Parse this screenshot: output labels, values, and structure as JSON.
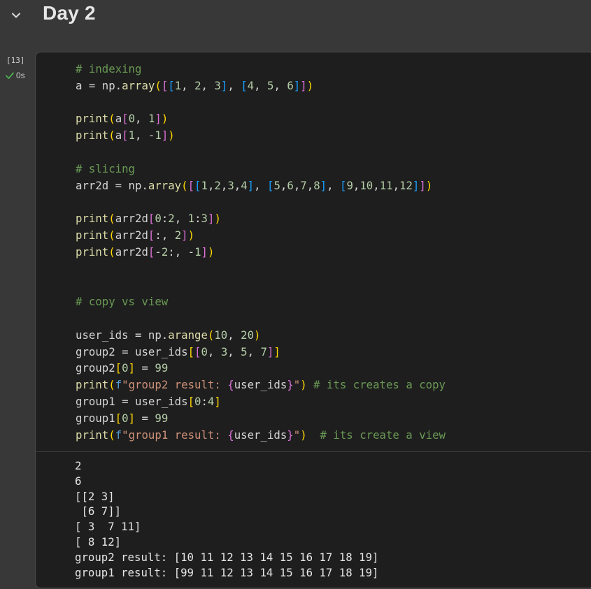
{
  "section": {
    "title": "Day 2",
    "collapse_icon": "chevron-down-icon"
  },
  "cell": {
    "execution_count": "[13]",
    "status_icon": "check-icon",
    "status_color": "#4caf50",
    "execution_time": "0s",
    "code_lines": [
      "# indexing",
      "a = np.array([[1, 2, 3], [4, 5, 6]])",
      "",
      "print(a[0, 1])",
      "print(a[1, -1])",
      "",
      "# slicing",
      "arr2d = np.array([[1,2,3,4], [5,6,7,8], [9,10,11,12]])",
      "",
      "print(arr2d[0:2, 1:3])",
      "print(arr2d[:, 2])",
      "print(arr2d[-2:, -1])",
      "",
      "",
      "# copy vs view",
      "",
      "user_ids = np.arange(10, 20)",
      "group2 = user_ids[[0, 3, 5, 7]]",
      "group2[0] = 99",
      "print(f\"group2 result: {user_ids}\") # its creates a copy",
      "group1 = user_ids[0:4]",
      "group1[0] = 99",
      "print(f\"group1 result: {user_ids}\")  # its create a view"
    ],
    "output_lines": [
      "2",
      "6",
      "[[2 3]",
      " [6 7]]",
      "[ 3  7 11]",
      "[ 8 12]",
      "group2 result: [10 11 12 13 14 15 16 17 18 19]",
      "group1 result: [99 11 12 13 14 15 16 17 18 19]"
    ]
  }
}
